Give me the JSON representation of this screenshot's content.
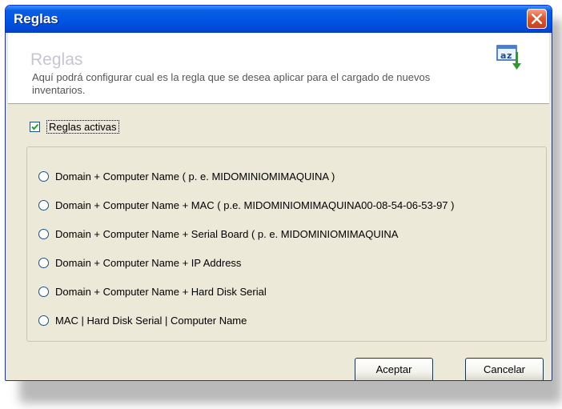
{
  "window": {
    "title": "Reglas"
  },
  "header": {
    "title": "Reglas",
    "description": "Aquí podrá configurar cual es la regla que se desea aplicar para el cargado de nuevos inventarios."
  },
  "active_rules": {
    "label": "Reglas activas",
    "checked": true
  },
  "rules": [
    {
      "label": "Domain + Computer Name ( p. e. MIDOMINIOMIMAQUINA )",
      "selected": false
    },
    {
      "label": "Domain + Computer Name + MAC ( p.e. MIDOMINIOMIMAQUINA00-08-54-06-53-97 )",
      "selected": false
    },
    {
      "label": "Domain + Computer Name + Serial Board ( p. e. MIDOMINIOMIMAQUINA",
      "selected": false
    },
    {
      "label": "Domain + Computer Name + IP Address",
      "selected": false
    },
    {
      "label": "Domain + Computer Name + Hard Disk Serial",
      "selected": false
    },
    {
      "label": "MAC | Hard Disk Serial | Computer Name",
      "selected": false
    }
  ],
  "buttons": {
    "accept": "Aceptar",
    "cancel": "Cancelar"
  },
  "icons": {
    "close": "close-icon",
    "header": "rules-icon"
  },
  "colors": {
    "titlebar": "#0055e5",
    "window_bg": "#ece9d8",
    "close": "#e2562b"
  }
}
